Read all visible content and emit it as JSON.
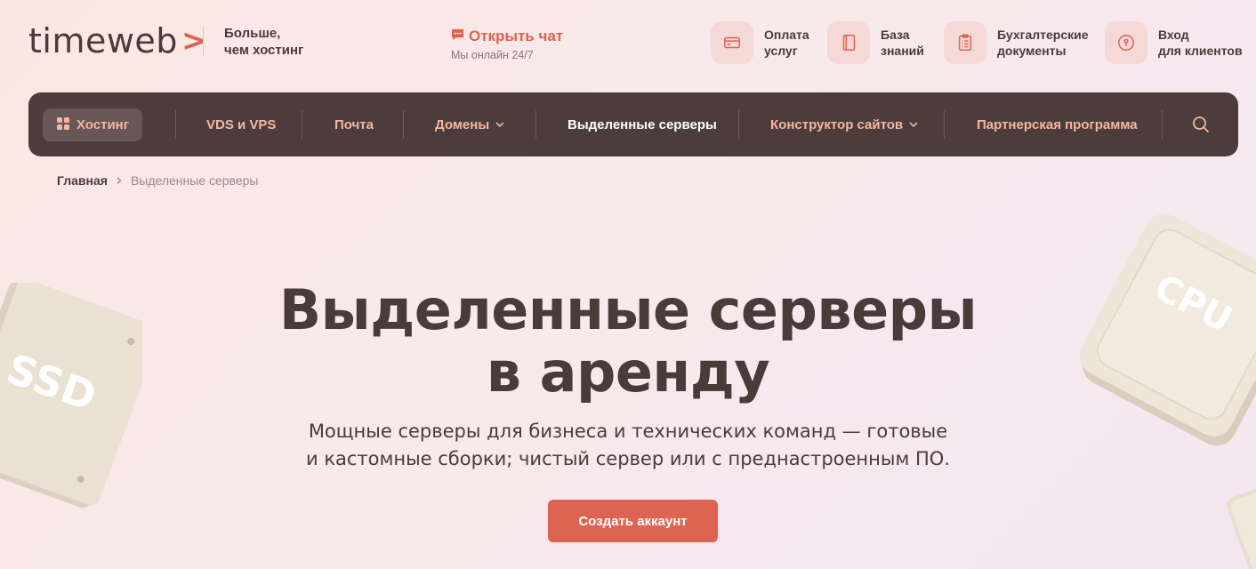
{
  "header": {
    "logo_text": "timeweb",
    "logo_chevron": ">",
    "tagline_line1": "Больше,",
    "tagline_line2": "чем хостинг",
    "chat": {
      "label": "Открыть чат",
      "subtext": "Мы онлайн 24/7",
      "icon": "chat-bubble-icon"
    },
    "items": [
      {
        "line1": "Оплата",
        "line2": "услуг",
        "icon": "card-icon"
      },
      {
        "line1": "База",
        "line2": "знаний",
        "icon": "book-icon"
      },
      {
        "line1": "Бухгалтерские",
        "line2": "документы",
        "icon": "clipboard-icon"
      },
      {
        "line1": "Вход",
        "line2": "для клиентов",
        "icon": "keyhole-icon"
      }
    ]
  },
  "nav": {
    "hosting": "Хостинг",
    "items": [
      {
        "label": "VDS и VPS"
      },
      {
        "label": "Почта"
      },
      {
        "label": "Домены",
        "dropdown": true
      },
      {
        "label": "Выделенные серверы",
        "active": true
      },
      {
        "label": "Конструктор сайтов",
        "dropdown": true
      },
      {
        "label": "Партнерская программа"
      }
    ],
    "search_icon": "search-icon"
  },
  "breadcrumb": {
    "home": "Главная",
    "current": "Выделенные серверы"
  },
  "hero": {
    "title_line1": "Выделенные серверы",
    "title_line2": "в аренду",
    "subtitle_line1": "Мощные серверы для бизнеса и технических команд — готовые",
    "subtitle_line2": "и кастомные сборки; чистый сервер или с преднастроенным ПО.",
    "cta": "Создать аккаунт"
  },
  "decor": {
    "left_chip": "SSD",
    "right_chip": "CPU"
  },
  "colors": {
    "accent": "#de6452",
    "nav_bg": "#4c3c3c",
    "nav_text": "#f5b79e",
    "text": "#4a3a3a",
    "icon_bg": "#f5d9d7"
  }
}
